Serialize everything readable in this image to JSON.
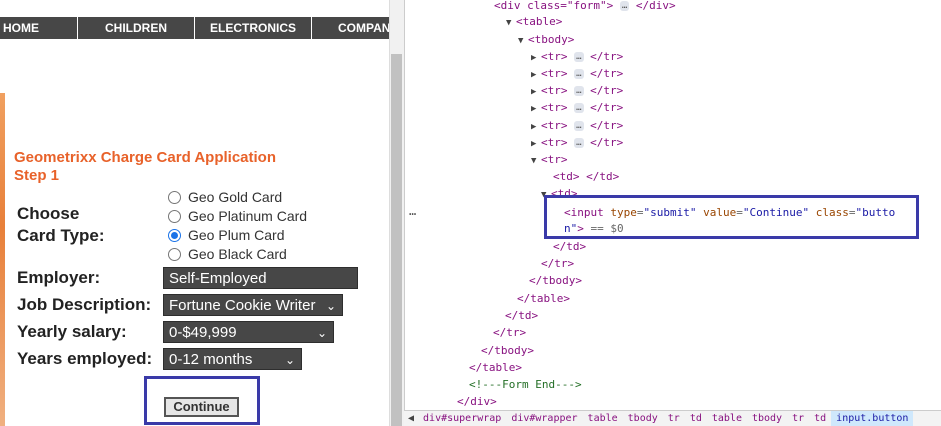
{
  "nav": {
    "items": [
      "HOME",
      "CHILDREN",
      "ELECTRONICS",
      "COMPAN"
    ]
  },
  "form": {
    "title_line1": "Geometrixx Charge Card Application",
    "title_line2": "Step 1",
    "card_type_label_1": "Choose",
    "card_type_label_2": "Card Type:",
    "card_options": [
      "Geo Gold Card",
      "Geo Platinum Card",
      "Geo Plum Card",
      "Geo Black Card"
    ],
    "selected_card": "Geo Plum Card",
    "employer_label": "Employer:",
    "employer_value": "Self-Employed",
    "job_label": "Job Description:",
    "job_value": "Fortune Cookie Writer",
    "salary_label": "Yearly salary:",
    "salary_value": "0-$49,999",
    "years_label": "Years employed:",
    "years_value": "0-12 months",
    "submit_label": "Continue"
  },
  "devtools": {
    "line_div_form": "<div class=\"form\">",
    "line_div_close": "</div>",
    "tag_table_open": "<table>",
    "tag_tbody_open": "<tbody>",
    "tag_tr_open": "<tr>",
    "tag_tr_close": "</tr>",
    "tag_td_open": "<td>",
    "tag_td_close": "</td>",
    "tag_tbody_close": "</tbody>",
    "tag_table_close": "</table>",
    "tag_div_close": "</div>",
    "ellipsis": "…",
    "td_collapsed": "<td>",
    "input_open": "<input",
    "attr_type_name": "type",
    "attr_type_value": "\"submit\"",
    "attr_value_name": "value",
    "attr_value_value": "\"Continue\"",
    "attr_class_name": "class",
    "attr_class_value_1": "\"butto",
    "attr_class_value_2": "n\"",
    "input_close": ">",
    "eq_dollar": "== $0",
    "comment": "<!---Form End--->",
    "row_dots": "…"
  },
  "breadcrumbs": [
    "div#superwrap",
    "div#wrapper",
    "table",
    "tbody",
    "tr",
    "td",
    "table",
    "tbody",
    "tr",
    "td",
    "input.button"
  ]
}
